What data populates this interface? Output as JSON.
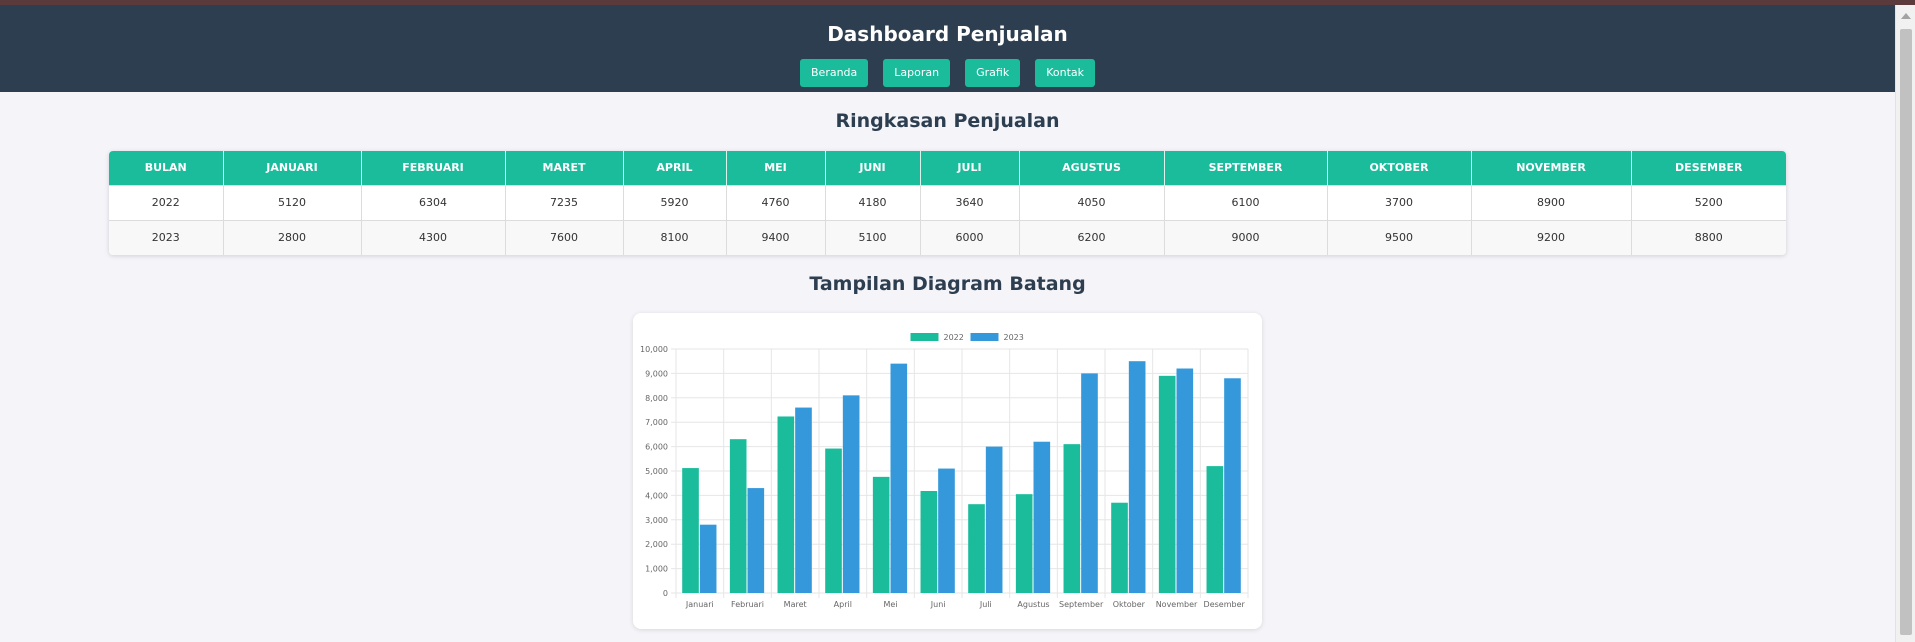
{
  "header": {
    "title": "Dashboard Penjualan",
    "nav": [
      "Beranda",
      "Laporan",
      "Grafik",
      "Kontak"
    ]
  },
  "summary": {
    "title": "Ringkasan Penjualan",
    "columns": [
      "BULAN",
      "JANUARI",
      "FEBRUARI",
      "MARET",
      "APRIL",
      "MEI",
      "JUNI",
      "JULI",
      "AGUSTUS",
      "SEPTEMBER",
      "OKTOBER",
      "NOVEMBER",
      "DESEMBER"
    ],
    "rows": [
      [
        "2022",
        "5120",
        "6304",
        "7235",
        "5920",
        "4760",
        "4180",
        "3640",
        "4050",
        "6100",
        "3700",
        "8900",
        "5200"
      ],
      [
        "2023",
        "2800",
        "4300",
        "7600",
        "8100",
        "9400",
        "5100",
        "6000",
        "6200",
        "9000",
        "9500",
        "9200",
        "8800"
      ]
    ]
  },
  "chart_section": {
    "title": "Tampilan Diagram Batang"
  },
  "colors": {
    "accent": "#1abc9c",
    "header_bg": "#2c3e50",
    "series_2023": "#3498db"
  },
  "chart_data": {
    "type": "bar",
    "categories": [
      "Januari",
      "Februari",
      "Maret",
      "April",
      "Mei",
      "Juni",
      "Juli",
      "Agustus",
      "September",
      "Oktober",
      "November",
      "Desember"
    ],
    "series": [
      {
        "name": "2022",
        "color": "#1abc9c",
        "values": [
          5120,
          6304,
          7235,
          5920,
          4760,
          4180,
          3640,
          4050,
          6100,
          3700,
          8900,
          5200
        ]
      },
      {
        "name": "2023",
        "color": "#3498db",
        "values": [
          2800,
          4300,
          7600,
          8100,
          9400,
          5100,
          6000,
          6200,
          9000,
          9500,
          9200,
          8800
        ]
      }
    ],
    "ylim": [
      0,
      10000
    ],
    "yticks": [
      "0",
      "1,000",
      "2,000",
      "3,000",
      "4,000",
      "5,000",
      "6,000",
      "7,000",
      "8,000",
      "9,000",
      "10,000"
    ],
    "grid": true,
    "legend": "top-center"
  }
}
